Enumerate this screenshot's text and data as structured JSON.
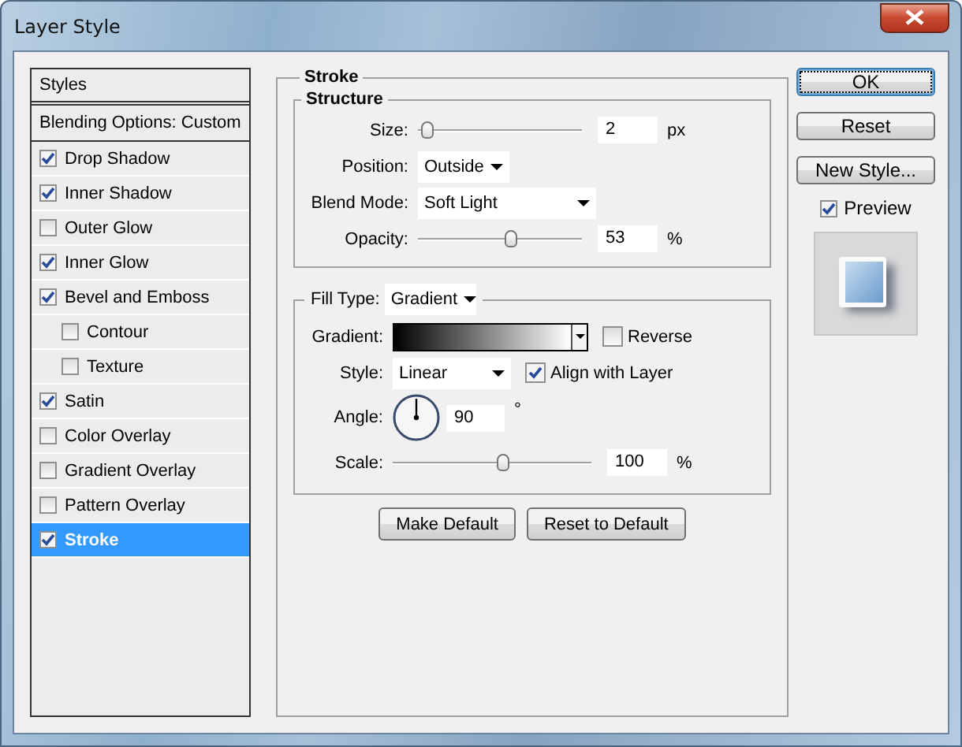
{
  "window": {
    "title": "Layer Style"
  },
  "styles_panel": {
    "header": "Styles",
    "blending": "Blending Options: Custom",
    "items": [
      {
        "label": "Drop Shadow",
        "kind": "effect",
        "checked": true,
        "selected": false
      },
      {
        "label": "Inner Shadow",
        "kind": "effect",
        "checked": true,
        "selected": false
      },
      {
        "label": "Outer Glow",
        "kind": "effect",
        "checked": false,
        "selected": false
      },
      {
        "label": "Inner Glow",
        "kind": "effect",
        "checked": true,
        "selected": false
      },
      {
        "label": "Bevel and Emboss",
        "kind": "effect",
        "checked": true,
        "selected": false
      },
      {
        "label": "Contour",
        "kind": "sub",
        "checked": false,
        "selected": false
      },
      {
        "label": "Texture",
        "kind": "sub",
        "checked": false,
        "selected": false
      },
      {
        "label": "Satin",
        "kind": "effect",
        "checked": true,
        "selected": false
      },
      {
        "label": "Color Overlay",
        "kind": "effect",
        "checked": false,
        "selected": false
      },
      {
        "label": "Gradient Overlay",
        "kind": "effect",
        "checked": false,
        "selected": false
      },
      {
        "label": "Pattern Overlay",
        "kind": "effect",
        "checked": false,
        "selected": false
      },
      {
        "label": "Stroke",
        "kind": "effect",
        "checked": true,
        "selected": true
      }
    ]
  },
  "stroke": {
    "title": "Stroke",
    "structure": {
      "title": "Structure",
      "size": {
        "label": "Size:",
        "value": "2",
        "unit": "px",
        "level": 0.02
      },
      "position": {
        "label": "Position:",
        "value": "Outside"
      },
      "blend_mode": {
        "label": "Blend Mode:",
        "value": "Soft Light"
      },
      "opacity": {
        "label": "Opacity:",
        "value": "53",
        "unit": "%",
        "level": 0.53
      }
    },
    "fill": {
      "label": "Fill Type:",
      "value": "Gradient",
      "gradient": {
        "label": "Gradient:"
      },
      "reverse": {
        "label": "Reverse",
        "checked": false
      },
      "style": {
        "label": "Style:",
        "value": "Linear"
      },
      "align": {
        "label": "Align with Layer",
        "checked": true
      },
      "angle": {
        "label": "Angle:",
        "value": "90",
        "unit": "°"
      },
      "scale": {
        "label": "Scale:",
        "value": "100",
        "unit": "%",
        "level": 0.52
      }
    },
    "buttons": [
      "Make Default",
      "Reset to Default"
    ]
  },
  "actions": {
    "buttons": [
      {
        "label": "OK",
        "default": true
      },
      {
        "label": "Reset",
        "default": false
      },
      {
        "label": "New Style...",
        "default": false
      }
    ],
    "preview": {
      "label": "Preview",
      "checked": true
    }
  }
}
